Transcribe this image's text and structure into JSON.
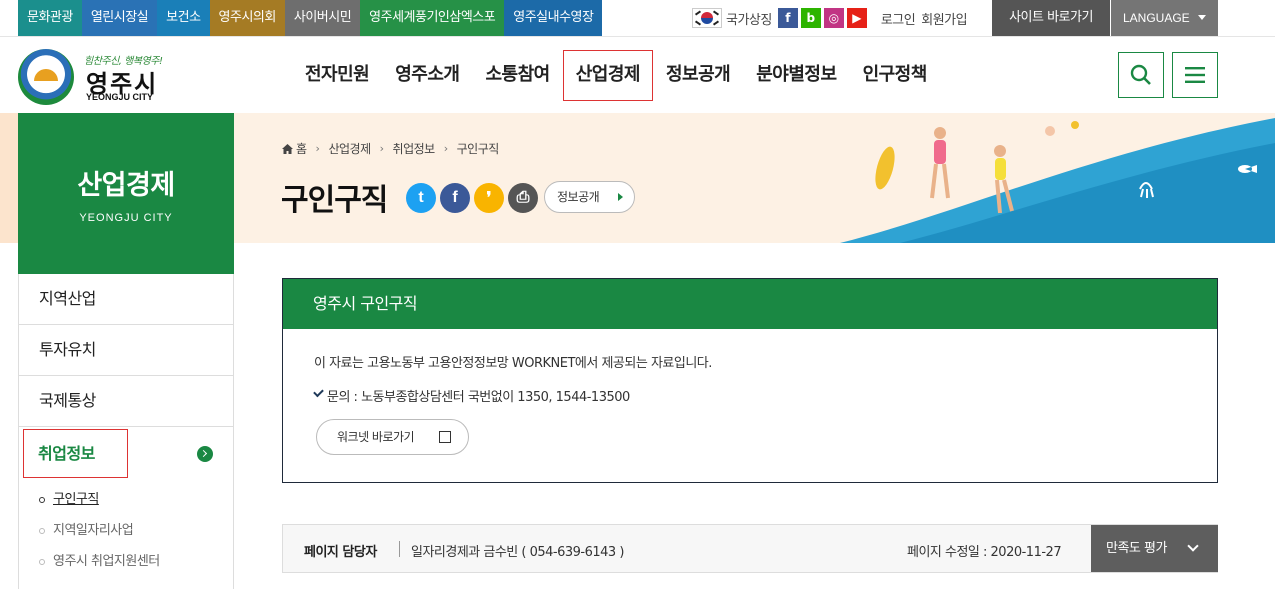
{
  "topbar": {
    "sites": [
      {
        "label": "문화관광",
        "color": "#1b8f8d"
      },
      {
        "label": "열린시장실",
        "color": "#2a72b5"
      },
      {
        "label": "보건소",
        "color": "#1a7fb8"
      },
      {
        "label": "영주시의회",
        "color": "#a57b24"
      },
      {
        "label": "사이버시민",
        "color": "#6e6e6e"
      },
      {
        "label": "영주세계풍기인삼엑스포",
        "color": "#269147"
      },
      {
        "label": "영주실내수영장",
        "color": "#1c6aa8"
      }
    ],
    "national_symbol": "국가상징",
    "sns": [
      {
        "icon": "facebook-icon",
        "glyph": "f",
        "color": "#3b5998"
      },
      {
        "icon": "blog-icon",
        "glyph": "b",
        "color": "#2db400"
      },
      {
        "icon": "instagram-icon",
        "glyph": "◎",
        "color": "#c13584"
      },
      {
        "icon": "youtube-icon",
        "glyph": "▶",
        "color": "#e62117"
      }
    ],
    "login": "로그인",
    "join": "회원가입",
    "quick_link": "사이트 바로가기",
    "language": "LANGUAGE"
  },
  "header": {
    "slogan": "힘찬주신, 행복영주!",
    "logo_name": "영주시",
    "logo_en": "YEONGJU CITY",
    "menu": [
      {
        "label": "전자민원",
        "active": false
      },
      {
        "label": "영주소개",
        "active": false
      },
      {
        "label": "소통참여",
        "active": false
      },
      {
        "label": "산업경제",
        "active": true
      },
      {
        "label": "정보공개",
        "active": false
      },
      {
        "label": "분야별정보",
        "active": false
      },
      {
        "label": "인구정책",
        "active": false
      }
    ],
    "search_icon": "search-icon",
    "menu_icon": "hamburger-icon"
  },
  "lnb": {
    "title": "산업경제",
    "subtitle": "YEONGJU CITY",
    "items": [
      {
        "label": "지역산업"
      },
      {
        "label": "투자유치"
      },
      {
        "label": "국제통상"
      },
      {
        "label": "취업정보"
      }
    ],
    "sub_items": [
      {
        "label": "구인구직",
        "on": true
      },
      {
        "label": "지역일자리사업",
        "on": false
      },
      {
        "label": "영주시 취업지원센터",
        "on": false
      }
    ]
  },
  "content": {
    "breadcrumb": [
      "홈",
      "산업경제",
      "취업정보",
      "구인구직"
    ],
    "title": "구인구직",
    "share": [
      {
        "icon": "twitter-icon",
        "glyph": "t",
        "color": "#1da1f2"
      },
      {
        "icon": "facebook-share-icon",
        "glyph": "f",
        "color": "#3b5998"
      },
      {
        "icon": "kakaostory-icon",
        "glyph": "❜",
        "color": "#f9b400"
      },
      {
        "icon": "print-icon",
        "glyph": "⎙",
        "color": "#555555"
      }
    ],
    "tag_button": "정보공개",
    "box_title": "영주시 구인구직",
    "box_text": "이 자료는 고용노동부 고용안정정보망 WORKNET에서 제공되는 자료입니다.",
    "contact": "문의 : 노동부종합상담센터 국번없이 1350, 1544-13500",
    "worknet_button": "워크넷 바로가기"
  },
  "footer": {
    "manager_label": "페이지 담당자",
    "manager": "일자리경제과 금수빈 ( 054-639-6143 )",
    "modified": "페이지 수정일 : 2020-11-27",
    "rate_button": "만족도 평가"
  },
  "colors": {
    "brand_green": "#1a8843",
    "highlight_red": "#dd3333"
  }
}
